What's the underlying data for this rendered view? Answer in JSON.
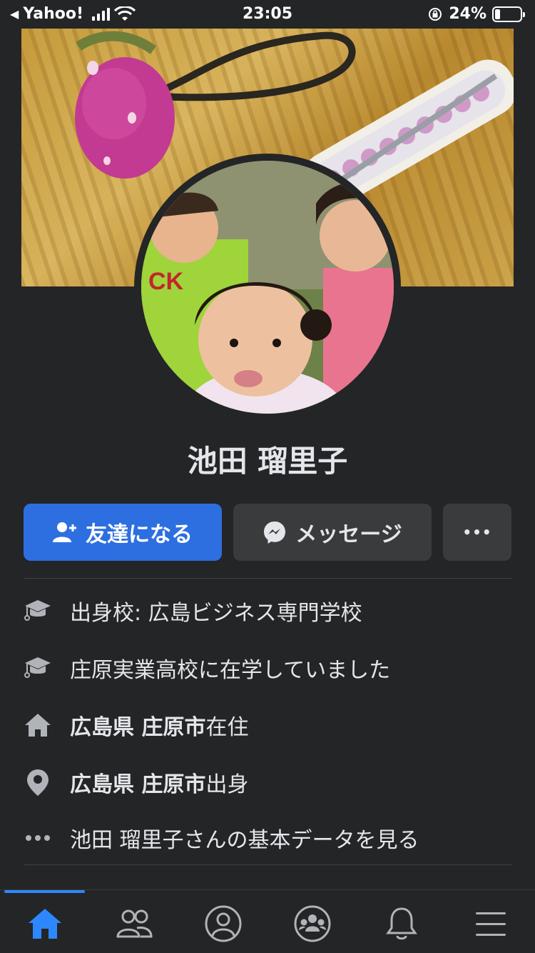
{
  "status_bar": {
    "back_app": "Yahoo!",
    "time": "23:05",
    "battery": "24%"
  },
  "profile": {
    "name": "池田 瑠里子"
  },
  "actions": {
    "add_friend": "友達になる",
    "message": "メッセージ",
    "more": "•••"
  },
  "info": {
    "school_prefix": "出身校: ",
    "school_name": "広島ビジネス専門学校",
    "highschool": "庄原実業高校に在学していました",
    "lives_place": "広島県 庄原市",
    "lives_suffix": "在住",
    "from_place": "広島県 庄原市",
    "from_suffix": "出身",
    "see_more": "池田 瑠里子さんの基本データを見る"
  },
  "icons": {
    "colors": {
      "primary": "#2d6fe0",
      "muted": "#b0b3b8",
      "active_tab": "#2d88ff"
    }
  }
}
